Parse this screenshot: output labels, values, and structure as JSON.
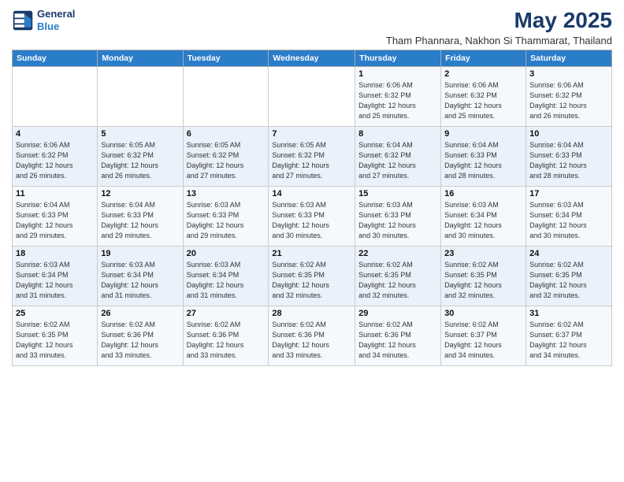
{
  "header": {
    "logo_line1": "General",
    "logo_line2": "Blue",
    "main_title": "May 2025",
    "sub_title": "Tham Phannara, Nakhon Si Thammarat, Thailand"
  },
  "weekdays": [
    "Sunday",
    "Monday",
    "Tuesday",
    "Wednesday",
    "Thursday",
    "Friday",
    "Saturday"
  ],
  "weeks": [
    [
      {
        "day": "",
        "info": ""
      },
      {
        "day": "",
        "info": ""
      },
      {
        "day": "",
        "info": ""
      },
      {
        "day": "",
        "info": ""
      },
      {
        "day": "1",
        "info": "Sunrise: 6:06 AM\nSunset: 6:32 PM\nDaylight: 12 hours\nand 25 minutes."
      },
      {
        "day": "2",
        "info": "Sunrise: 6:06 AM\nSunset: 6:32 PM\nDaylight: 12 hours\nand 25 minutes."
      },
      {
        "day": "3",
        "info": "Sunrise: 6:06 AM\nSunset: 6:32 PM\nDaylight: 12 hours\nand 26 minutes."
      }
    ],
    [
      {
        "day": "4",
        "info": "Sunrise: 6:06 AM\nSunset: 6:32 PM\nDaylight: 12 hours\nand 26 minutes."
      },
      {
        "day": "5",
        "info": "Sunrise: 6:05 AM\nSunset: 6:32 PM\nDaylight: 12 hours\nand 26 minutes."
      },
      {
        "day": "6",
        "info": "Sunrise: 6:05 AM\nSunset: 6:32 PM\nDaylight: 12 hours\nand 27 minutes."
      },
      {
        "day": "7",
        "info": "Sunrise: 6:05 AM\nSunset: 6:32 PM\nDaylight: 12 hours\nand 27 minutes."
      },
      {
        "day": "8",
        "info": "Sunrise: 6:04 AM\nSunset: 6:32 PM\nDaylight: 12 hours\nand 27 minutes."
      },
      {
        "day": "9",
        "info": "Sunrise: 6:04 AM\nSunset: 6:33 PM\nDaylight: 12 hours\nand 28 minutes."
      },
      {
        "day": "10",
        "info": "Sunrise: 6:04 AM\nSunset: 6:33 PM\nDaylight: 12 hours\nand 28 minutes."
      }
    ],
    [
      {
        "day": "11",
        "info": "Sunrise: 6:04 AM\nSunset: 6:33 PM\nDaylight: 12 hours\nand 29 minutes."
      },
      {
        "day": "12",
        "info": "Sunrise: 6:04 AM\nSunset: 6:33 PM\nDaylight: 12 hours\nand 29 minutes."
      },
      {
        "day": "13",
        "info": "Sunrise: 6:03 AM\nSunset: 6:33 PM\nDaylight: 12 hours\nand 29 minutes."
      },
      {
        "day": "14",
        "info": "Sunrise: 6:03 AM\nSunset: 6:33 PM\nDaylight: 12 hours\nand 30 minutes."
      },
      {
        "day": "15",
        "info": "Sunrise: 6:03 AM\nSunset: 6:33 PM\nDaylight: 12 hours\nand 30 minutes."
      },
      {
        "day": "16",
        "info": "Sunrise: 6:03 AM\nSunset: 6:34 PM\nDaylight: 12 hours\nand 30 minutes."
      },
      {
        "day": "17",
        "info": "Sunrise: 6:03 AM\nSunset: 6:34 PM\nDaylight: 12 hours\nand 30 minutes."
      }
    ],
    [
      {
        "day": "18",
        "info": "Sunrise: 6:03 AM\nSunset: 6:34 PM\nDaylight: 12 hours\nand 31 minutes."
      },
      {
        "day": "19",
        "info": "Sunrise: 6:03 AM\nSunset: 6:34 PM\nDaylight: 12 hours\nand 31 minutes."
      },
      {
        "day": "20",
        "info": "Sunrise: 6:03 AM\nSunset: 6:34 PM\nDaylight: 12 hours\nand 31 minutes."
      },
      {
        "day": "21",
        "info": "Sunrise: 6:02 AM\nSunset: 6:35 PM\nDaylight: 12 hours\nand 32 minutes."
      },
      {
        "day": "22",
        "info": "Sunrise: 6:02 AM\nSunset: 6:35 PM\nDaylight: 12 hours\nand 32 minutes."
      },
      {
        "day": "23",
        "info": "Sunrise: 6:02 AM\nSunset: 6:35 PM\nDaylight: 12 hours\nand 32 minutes."
      },
      {
        "day": "24",
        "info": "Sunrise: 6:02 AM\nSunset: 6:35 PM\nDaylight: 12 hours\nand 32 minutes."
      }
    ],
    [
      {
        "day": "25",
        "info": "Sunrise: 6:02 AM\nSunset: 6:35 PM\nDaylight: 12 hours\nand 33 minutes."
      },
      {
        "day": "26",
        "info": "Sunrise: 6:02 AM\nSunset: 6:36 PM\nDaylight: 12 hours\nand 33 minutes."
      },
      {
        "day": "27",
        "info": "Sunrise: 6:02 AM\nSunset: 6:36 PM\nDaylight: 12 hours\nand 33 minutes."
      },
      {
        "day": "28",
        "info": "Sunrise: 6:02 AM\nSunset: 6:36 PM\nDaylight: 12 hours\nand 33 minutes."
      },
      {
        "day": "29",
        "info": "Sunrise: 6:02 AM\nSunset: 6:36 PM\nDaylight: 12 hours\nand 34 minutes."
      },
      {
        "day": "30",
        "info": "Sunrise: 6:02 AM\nSunset: 6:37 PM\nDaylight: 12 hours\nand 34 minutes."
      },
      {
        "day": "31",
        "info": "Sunrise: 6:02 AM\nSunset: 6:37 PM\nDaylight: 12 hours\nand 34 minutes."
      }
    ]
  ]
}
